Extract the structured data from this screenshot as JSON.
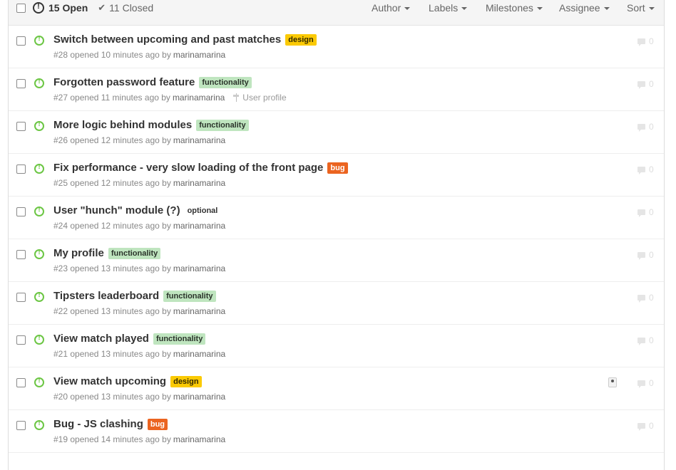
{
  "header": {
    "open_count_label": "15 Open",
    "closed_count_label": "11 Closed",
    "filters": [
      "Author",
      "Labels",
      "Milestones",
      "Assignee",
      "Sort"
    ]
  },
  "issues": [
    {
      "title": "Switch between upcoming and past matches",
      "label": "design",
      "label_color": "#fbca04",
      "number": "#28",
      "opened": "opened 10 minutes ago by",
      "author": "marinamarina",
      "milestone": "",
      "comments": "0"
    },
    {
      "title": "Forgotten password feature",
      "label": "functionality",
      "label_color": "#bfe5bf",
      "number": "#27",
      "opened": "opened 11 minutes ago by",
      "author": "marinamarina",
      "milestone": "User profile",
      "comments": "0"
    },
    {
      "title": "More logic behind modules",
      "label": "functionality",
      "label_color": "#bfe5bf",
      "number": "#26",
      "opened": "opened 12 minutes ago by",
      "author": "marinamarina",
      "milestone": "",
      "comments": "0"
    },
    {
      "title": "Fix performance - very slow loading of the front page",
      "label": "bug",
      "label_color": "#eb6420",
      "number": "#25",
      "opened": "opened 12 minutes ago by",
      "author": "marinamarina",
      "milestone": "",
      "comments": "0"
    },
    {
      "title": "User \"hunch\" module (?)",
      "label": "optional",
      "label_color": "#ffffff",
      "number": "#24",
      "opened": "opened 12 minutes ago by",
      "author": "marinamarina",
      "milestone": "",
      "comments": "0"
    },
    {
      "title": "My profile",
      "label": "functionality",
      "label_color": "#bfe5bf",
      "number": "#23",
      "opened": "opened 13 minutes ago by",
      "author": "marinamarina",
      "milestone": "",
      "comments": "0"
    },
    {
      "title": "Tipsters leaderboard",
      "label": "functionality",
      "label_color": "#bfe5bf",
      "number": "#22",
      "opened": "opened 13 minutes ago by",
      "author": "marinamarina",
      "milestone": "",
      "comments": "0"
    },
    {
      "title": "View match played",
      "label": "functionality",
      "label_color": "#bfe5bf",
      "number": "#21",
      "opened": "opened 13 minutes ago by",
      "author": "marinamarina",
      "milestone": "",
      "comments": "0"
    },
    {
      "title": "View match upcoming",
      "label": "design",
      "label_color": "#fbca04",
      "number": "#20",
      "opened": "opened 13 minutes ago by",
      "author": "marinamarina",
      "milestone": "",
      "comments": "0",
      "has_assignee": true
    },
    {
      "title": "Bug - JS clashing",
      "label": "bug",
      "label_color": "#eb6420",
      "number": "#19",
      "opened": "opened 14 minutes ago by",
      "author": "marinamarina",
      "milestone": "",
      "comments": "0"
    }
  ]
}
